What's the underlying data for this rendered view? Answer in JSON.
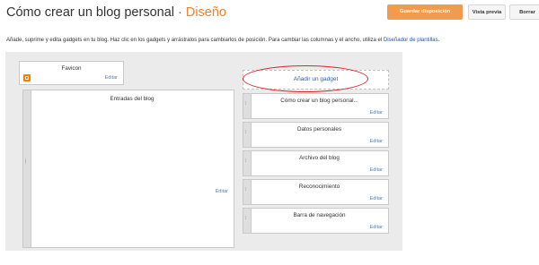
{
  "header": {
    "blog_title": "Cómo crear un blog personal",
    "separator": "·",
    "section_title": "Diseño",
    "save_label": "Guardar disposición",
    "preview_label": "Vista previa",
    "delete_label": "Borrar"
  },
  "instructions": {
    "text": "Añade, suprime y edita gadgets en tu blog. Haz clic en los gadgets y arrástralos para cambiarlos de posición. Para cambiar las columnas y el ancho, utiliza el ",
    "link": "Diseñador de plantillas",
    "end": "."
  },
  "left_column": {
    "favicon": {
      "title": "Favicon",
      "edit": "Editar"
    },
    "posts": {
      "title": "Entradas del blog",
      "edit": "Editar"
    }
  },
  "sidebar": {
    "add_gadget": "Añadir un gadget",
    "gadgets": [
      {
        "title": "Cómo crear un blog personal...",
        "edit": "Editar"
      },
      {
        "title": "Datos personales",
        "edit": "Editar"
      },
      {
        "title": "Archivo del blog",
        "edit": "Editar"
      },
      {
        "title": "Reconocimiento",
        "edit": "Editar"
      },
      {
        "title": "Barra de navegación",
        "edit": "Editar"
      }
    ]
  },
  "colors": {
    "accent": "#f39a4c",
    "highlight": "#d9252b",
    "link": "#2a5db0"
  },
  "icons": {
    "favicon": "blogger-icon",
    "drag": "drag-handle-icon"
  }
}
